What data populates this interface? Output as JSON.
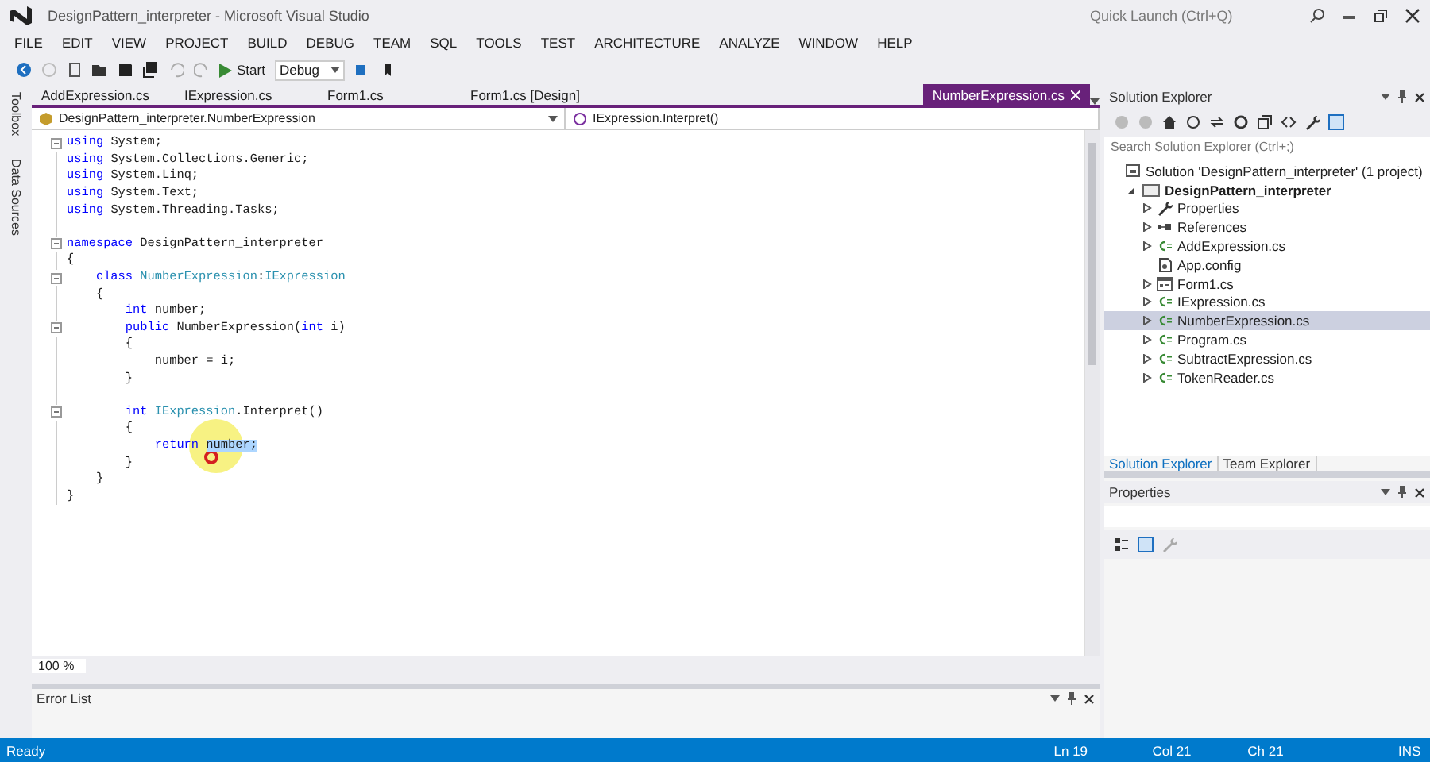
{
  "window": {
    "title": "DesignPattern_interpreter - Microsoft Visual Studio",
    "quick_launch": {
      "placeholder": "Quick Launch (Ctrl+Q)"
    }
  },
  "menu": [
    "FILE",
    "EDIT",
    "VIEW",
    "PROJECT",
    "BUILD",
    "DEBUG",
    "TEAM",
    "SQL",
    "TOOLS",
    "TEST",
    "ARCHITECTURE",
    "ANALYZE",
    "WINDOW",
    "HELP"
  ],
  "toolbar": {
    "start": "Start",
    "configuration": "Debug"
  },
  "side_tabs": [
    "Toolbox",
    "Data Sources"
  ],
  "doc_tabs": [
    {
      "label": "AddExpression.cs",
      "selected": false
    },
    {
      "label": "IExpression.cs",
      "selected": false
    },
    {
      "label": "Form1.cs",
      "selected": false
    },
    {
      "label": "Form1.cs [Design]",
      "selected": false
    },
    {
      "label": "NumberExpression.cs",
      "selected": true
    }
  ],
  "nav_bar": {
    "type": "DesignPattern_interpreter.NumberExpression",
    "member": "IExpression.Interpret()"
  },
  "code": [
    {
      "fold": true,
      "tokens": [
        {
          "kind": "keyword",
          "text": "using"
        },
        {
          "kind": "plain",
          "text": " System;"
        }
      ]
    },
    {
      "fold": false,
      "tokens": [
        {
          "kind": "keyword",
          "text": "using"
        },
        {
          "kind": "plain",
          "text": " System.Collections.Generic;"
        }
      ]
    },
    {
      "fold": false,
      "tokens": [
        {
          "kind": "keyword",
          "text": "using"
        },
        {
          "kind": "plain",
          "text": " System.Linq;"
        }
      ]
    },
    {
      "fold": false,
      "tokens": [
        {
          "kind": "keyword",
          "text": "using"
        },
        {
          "kind": "plain",
          "text": " System.Text;"
        }
      ]
    },
    {
      "fold": false,
      "tokens": [
        {
          "kind": "keyword",
          "text": "using"
        },
        {
          "kind": "plain",
          "text": " System.Threading.Tasks;"
        }
      ]
    },
    {
      "fold": false
    },
    {
      "fold": true,
      "tokens": [
        {
          "kind": "keyword",
          "text": "namespace"
        },
        {
          "kind": "plain",
          "text": " DesignPattern_interpreter"
        }
      ]
    },
    {
      "fold": false,
      "tokens": [
        {
          "kind": "plain",
          "text": "{"
        }
      ]
    },
    {
      "fold": true,
      "tokens": [
        {
          "kind": "keyword",
          "text": "    class "
        },
        {
          "kind": "type",
          "text": "NumberExpression"
        },
        {
          "kind": "plain",
          "text": ":"
        },
        {
          "kind": "type",
          "text": "IExpression"
        }
      ]
    },
    {
      "fold": false,
      "tokens": [
        {
          "kind": "plain",
          "text": "    {"
        }
      ]
    },
    {
      "fold": false,
      "tokens": [
        {
          "kind": "keyword",
          "text": "        int"
        },
        {
          "kind": "plain",
          "text": " number;"
        }
      ]
    },
    {
      "fold": true,
      "tokens": [
        {
          "kind": "keyword",
          "text": "        public"
        },
        {
          "kind": "plain",
          "text": " NumberExpression("
        },
        {
          "kind": "keyword",
          "text": "int"
        },
        {
          "kind": "plain",
          "text": " i)"
        }
      ]
    },
    {
      "fold": false,
      "tokens": [
        {
          "kind": "plain",
          "text": "        {"
        }
      ]
    },
    {
      "fold": false,
      "tokens": [
        {
          "kind": "plain",
          "text": "            number = i;"
        }
      ]
    },
    {
      "fold": false,
      "tokens": [
        {
          "kind": "plain",
          "text": "        }"
        }
      ]
    },
    {
      "fold": false
    },
    {
      "fold": true,
      "tokens": [
        {
          "kind": "keyword",
          "text": "        int "
        },
        {
          "kind": "type",
          "text": "IExpression"
        },
        {
          "kind": "plain",
          "text": ".Interpret()"
        }
      ]
    },
    {
      "fold": false,
      "tokens": [
        {
          "kind": "plain",
          "text": "        {"
        }
      ]
    },
    {
      "fold": false,
      "tokens": [
        {
          "kind": "keyword",
          "text": "            return "
        },
        {
          "kind": "selected",
          "text": "number;"
        }
      ]
    },
    {
      "fold": false,
      "tokens": [
        {
          "kind": "plain",
          "text": "        }"
        }
      ]
    },
    {
      "fold": false,
      "tokens": [
        {
          "kind": "plain",
          "text": "    }"
        }
      ]
    },
    {
      "fold": false,
      "tokens": [
        {
          "kind": "plain",
          "text": "}"
        }
      ]
    }
  ],
  "zoom": "100 %",
  "error_list": {
    "title": "Error List"
  },
  "solution_explorer": {
    "title": "Solution Explorer",
    "search": {
      "placeholder": "Search Solution Explorer (Ctrl+;)"
    },
    "tree": [
      {
        "label": "Solution 'DesignPattern_interpreter' (1 project)",
        "kind": "solution",
        "selected": false,
        "children": [
          {
            "label": "DesignPattern_interpreter",
            "kind": "project",
            "expanded": true,
            "selected": false,
            "children": [
              {
                "label": "Properties",
                "kind": "properties",
                "expanded": false,
                "selected": false
              },
              {
                "label": "References",
                "kind": "references",
                "expanded": false,
                "selected": false
              },
              {
                "label": "AddExpression.cs",
                "kind": "code",
                "expanded": false,
                "selected": false
              },
              {
                "label": "App.config",
                "kind": "config",
                "selected": false
              },
              {
                "label": "Form1.cs",
                "kind": "form",
                "expanded": false,
                "selected": false
              },
              {
                "label": "IExpression.cs",
                "kind": "code",
                "expanded": false,
                "selected": false
              },
              {
                "label": "NumberExpression.cs",
                "kind": "code",
                "expanded": false,
                "selected": true
              },
              {
                "label": "Program.cs",
                "kind": "code",
                "expanded": false,
                "selected": false
              },
              {
                "label": "SubtractExpression.cs",
                "kind": "code",
                "expanded": false,
                "selected": false
              },
              {
                "label": "TokenReader.cs",
                "kind": "code",
                "expanded": false,
                "selected": false
              }
            ]
          }
        ]
      }
    ],
    "tabs": [
      {
        "label": "Solution Explorer",
        "selected": true
      },
      {
        "label": "Team Explorer",
        "selected": false
      }
    ]
  },
  "properties": {
    "title": "Properties"
  },
  "status_bar": {
    "message": "Ready",
    "line": "Ln 19",
    "column": "Col 21",
    "char": "Ch 21",
    "mode": "INS"
  }
}
